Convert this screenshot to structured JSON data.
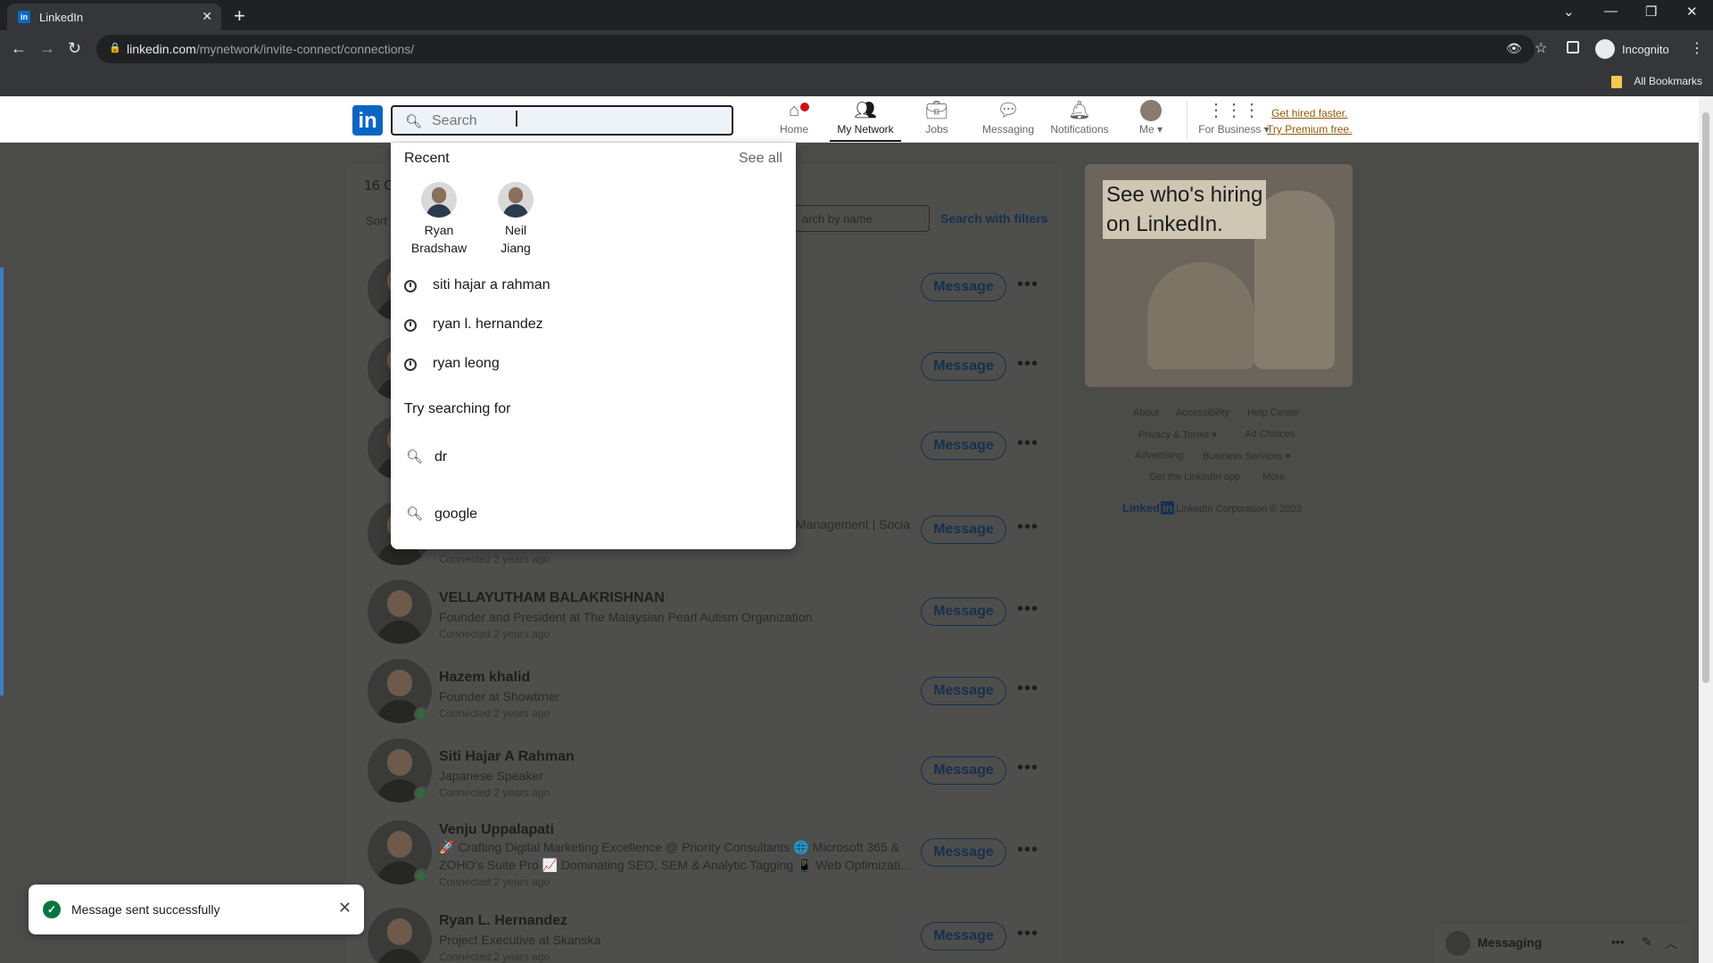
{
  "browser": {
    "tab_title": "LinkedIn",
    "tab_favicon": "in",
    "url_host": "linkedin.com",
    "url_path": "/mynetwork/invite-connect/connections/",
    "incognito_label": "Incognito",
    "bookmarks_label": "All Bookmarks"
  },
  "nav": {
    "search_placeholder": "Search",
    "items": [
      {
        "label": "Home",
        "icon": "home-icon"
      },
      {
        "label": "My Network",
        "icon": "network-icon"
      },
      {
        "label": "Jobs",
        "icon": "briefcase-icon"
      },
      {
        "label": "Messaging",
        "icon": "chat-icon"
      },
      {
        "label": "Notifications",
        "icon": "bell-icon"
      },
      {
        "label": "Me",
        "icon": "avatar-icon"
      },
      {
        "label": "For Business",
        "icon": "grid-icon"
      }
    ],
    "premium_line1": "Get hired faster.",
    "premium_line2": "Try Premium free."
  },
  "dropdown": {
    "recent_label": "Recent",
    "see_all": "See all",
    "recent_people": [
      {
        "first": "Ryan",
        "last": "Bradshaw"
      },
      {
        "first": "Neil",
        "last": "Jiang"
      }
    ],
    "history": [
      "siti hajar a rahman",
      "ryan l. hernandez",
      "ryan leong"
    ],
    "try_label": "Try searching for",
    "suggestions": [
      "dr",
      "google"
    ]
  },
  "connections": {
    "count_partial": "16 C",
    "sort_partial": "Sort",
    "search_placeholder": "arch by name",
    "search_filters": "Search with filters",
    "message_label": "Message",
    "more_label": "•••",
    "rows": [
      {
        "name": "",
        "desc": "",
        "desc2": "",
        "conn": ""
      },
      {
        "name": "",
        "desc": "",
        "desc2": "",
        "conn": ""
      },
      {
        "name": "",
        "desc": "",
        "desc2": "",
        "conn": ""
      },
      {
        "name": "",
        "desc": "Management | Socia",
        "desc2": "",
        "conn": "Connected 2 years ago"
      },
      {
        "name": "VELLAYUTHAM BALAKRISHNAN",
        "desc": "Founder and President at The Malaysian Pearl Autism Organization",
        "desc2": "",
        "conn": "Connected 2 years ago"
      },
      {
        "name": "Hazem khalid",
        "desc": "Founder at Showtrner",
        "desc2": "",
        "conn": "Connected 2 years ago"
      },
      {
        "name": "Siti Hajar A Rahman",
        "desc": "Japanese Speaker",
        "desc2": "",
        "conn": "Connected 2 years ago"
      },
      {
        "name": "Venju Uppalapati",
        "desc": "🚀 Crafting Digital Marketing Excellence @ Priority Consultants 🌐 Microsoft 365 &",
        "desc2": "ZOHO's Suite Pro 📈 Dominating SEO, SEM & Analytic Tagging 📱 Web Optimizati...",
        "conn": "Connected 2 years ago"
      },
      {
        "name": "Ryan L. Hernandez",
        "desc": "Project Executive at Skanska",
        "desc2": "",
        "conn": "Connected 2 years ago"
      }
    ]
  },
  "ad": {
    "line1": "See who's hiring",
    "line2": "on LinkedIn."
  },
  "footer": {
    "links": [
      "About",
      "Accessibility",
      "Help Center",
      "Privacy & Terms ▾",
      "Ad Choices",
      "Advertising",
      "Business Services ▾",
      "Get the LinkedIn app",
      "More"
    ],
    "brand": "Linked",
    "brand_in": "in",
    "copyright": "LinkedIn Corporation © 2023"
  },
  "toast": {
    "text": "Message sent successfully"
  },
  "messaging": {
    "label": "Messaging"
  },
  "colors": {
    "brand": "#0a66c2",
    "success": "#057642",
    "notification": "#cc1016"
  }
}
